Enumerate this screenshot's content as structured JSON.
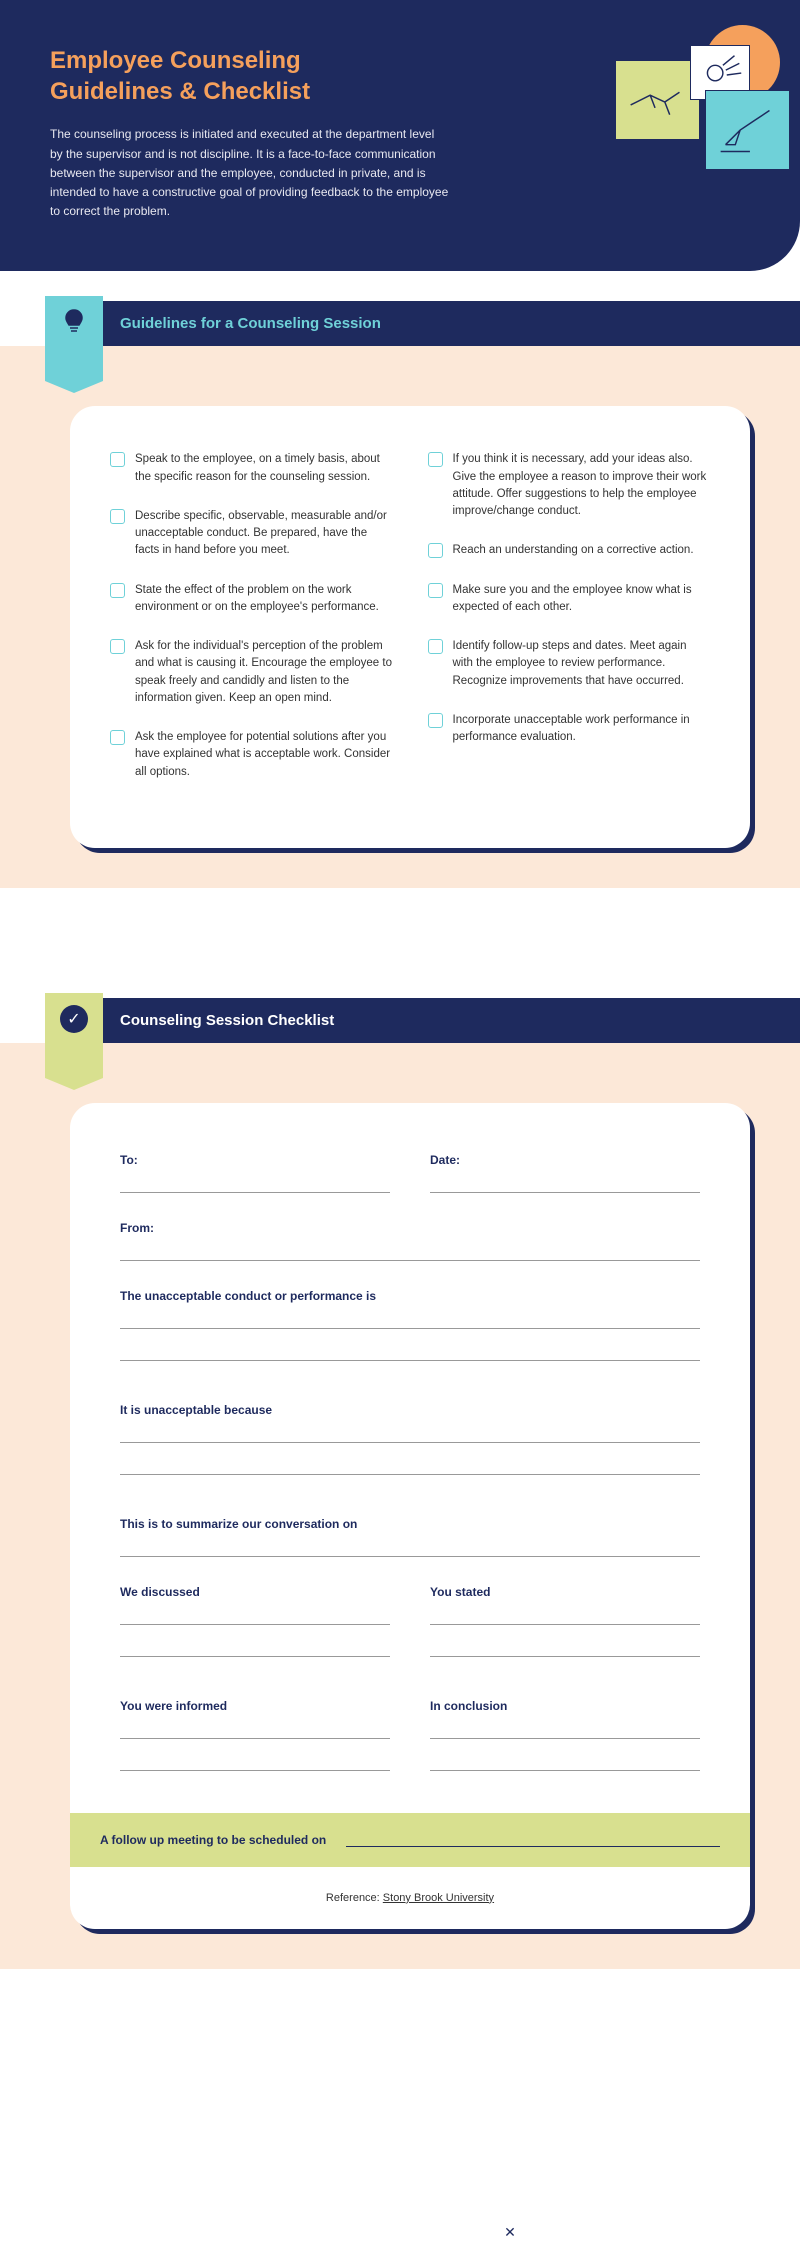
{
  "header": {
    "title": "Employee Counseling Guidelines & Checklist",
    "description": "The counseling process is initiated and executed at the department level by the supervisor and is not discipline. It is a face-to-face communication between the supervisor and the employee, conducted in private, and is intended to have a constructive goal of providing feedback to the employee to correct the problem."
  },
  "section1": {
    "title": "Guidelines for a Counseling Session",
    "col1": [
      "Speak to the employee, on a timely basis, about the specific reason for the counseling session.",
      "Describe specific, observable, measurable and/or unacceptable conduct. Be prepared, have the facts in hand before you meet.",
      "State the effect of the problem on the work environment or on the employee's performance.",
      "Ask for the individual's perception of the problem and what is causing it. Encourage the employee to speak freely and candidly and listen to the information given. Keep an open mind.",
      "Ask the employee for potential solutions after you have explained what is acceptable work. Consider all options."
    ],
    "col2": [
      "If you think it is necessary, add your ideas also. Give the employee a reason to improve their work attitude. Offer suggestions to help the employee improve/change conduct.",
      "Reach an understanding on a corrective action.",
      "Make sure you and the employee know what is expected of each other.",
      "Identify follow-up steps and dates. Meet again with the employee to review performance. Recognize improvements that have occurred.",
      "Incorporate unacceptable work performance in performance evaluation."
    ]
  },
  "section2": {
    "title": "Counseling Session Checklist",
    "fields": {
      "to": "To:",
      "date": "Date:",
      "from": "From:",
      "conduct": "The unacceptable conduct or performance is",
      "because": "It is unacceptable because",
      "summarize": "This is to summarize our conversation on",
      "discussed": "We discussed",
      "stated": "You stated",
      "informed": "You were informed",
      "conclusion": "In conclusion",
      "followup": "A follow up meeting to be scheduled on"
    }
  },
  "reference": {
    "label": "Reference: ",
    "link": "Stony Brook University"
  }
}
